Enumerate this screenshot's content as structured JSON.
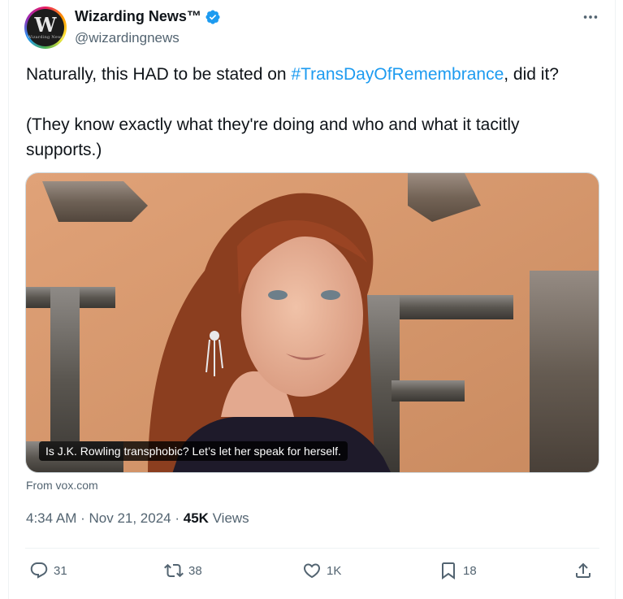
{
  "author": {
    "display_name": "Wizarding News™",
    "handle": "@wizardingnews",
    "avatar_letter": "W",
    "avatar_subtext": "Wizarding News"
  },
  "tweet": {
    "line1_pre": "Naturally, this HAD to be stated on ",
    "hashtag": "#TransDayOfRemembrance",
    "line1_post": ", did it?",
    "line2": "(They know exactly what they're doing and who and what it tacitly supports.)"
  },
  "link_card": {
    "caption": "Is J.K. Rowling transphobic? Let’s let her speak for herself.",
    "source": "From vox.com"
  },
  "meta": {
    "time": "4:34 AM",
    "sep1": " · ",
    "date": "Nov 21, 2024",
    "sep2": " · ",
    "views_count": "45K",
    "views_label": " Views"
  },
  "actions": {
    "replies": "31",
    "reposts": "38",
    "likes": "1K",
    "bookmarks": "18"
  },
  "icons": {
    "more": "more-horizontal-icon",
    "verified": "verified-badge-icon",
    "reply": "reply-icon",
    "repost": "repost-icon",
    "like": "heart-icon",
    "bookmark": "bookmark-icon",
    "share": "share-icon"
  },
  "colors": {
    "accent": "#1d9bf0",
    "text": "#0f1419",
    "muted": "#536471"
  }
}
